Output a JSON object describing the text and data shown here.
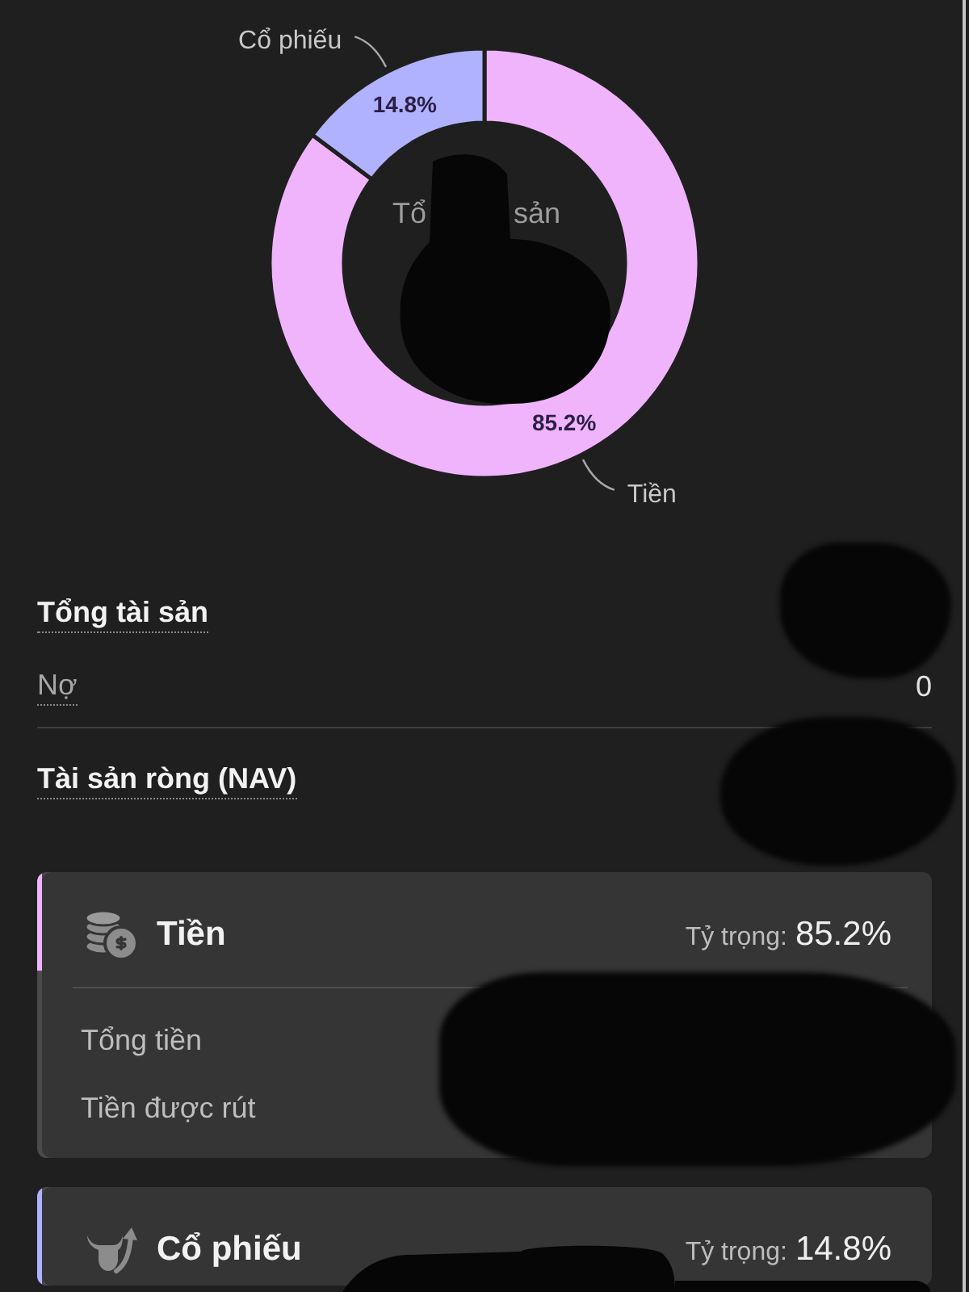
{
  "chart": {
    "center_text": [
      "Tổ",
      "sản"
    ],
    "chart_data": {
      "type": "donut",
      "categories": [
        "Tiền",
        "Cổ phiếu"
      ],
      "values": [
        85.2,
        14.8
      ],
      "value_labels": [
        "85.2%",
        "14.8%"
      ]
    }
  },
  "summary": [
    {
      "kind": "total",
      "label": "Tổng tài sản"
    },
    {
      "kind": "liability",
      "label": "Nợ",
      "value": "0"
    },
    {
      "kind": "net",
      "label": "Tài sản ròng (NAV)"
    }
  ],
  "cards": [
    {
      "kind": "cash",
      "color": "#f0b4fc",
      "title": "Tiền",
      "weight_label": "Tỷ trọng:",
      "weight": "85.2%",
      "rows": [
        {
          "label": "Tổng tiền"
        },
        {
          "label": "Tiền được rút"
        }
      ]
    },
    {
      "kind": "stock",
      "color": "#b0b2ff",
      "title": "Cổ phiếu",
      "weight_label": "Tỷ trọng:",
      "weight": "14.8%"
    }
  ]
}
